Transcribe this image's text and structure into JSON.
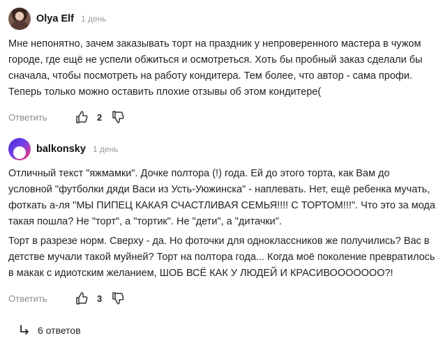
{
  "comments": [
    {
      "author": "Olya Elf",
      "time": "1 день",
      "paragraphs": [
        "Мне непонятно, зачем заказывать торт на праздник у непроверенного мастера в чужом городе, где ещё не успели обжиться и осмотреться. Хоть бы пробный заказ сделали бы сначала, чтобы посмотреть на работу кондитера. Тем более, что автор - сама профи. Теперь только можно оставить плохие отзывы об этом кондитере("
      ],
      "reply_label": "Ответить",
      "likes": "2"
    },
    {
      "author": "balkonsky",
      "time": "1 день",
      "paragraphs": [
        "Отличный текст \"яжмамки\". Дочке полтора (!) года. Ей до этого торта, как Вам до условной \"футболки дяди Васи из Усть-Уюжинска\" - наплевать. Нет, ещё ребенка мучать, фоткать а-ля \"МЫ ПИПЕЦ КАКАЯ СЧАСТЛИВАЯ СЕМЬЯ!!!! С ТОРТОМ!!!\". Что это за мода такая пошла? Не \"торт\", а \"тортик\". Не \"дети\", а \"дитачки\".",
        "Торт в разрезе норм. Сверху - да. Но фоточки для одноклассников же получились? Вас в детстве мучали такой муйней? Торт на полтора года... Когда моё поколение превратилось в макак с идиотским желанием, ШОБ ВСЁ КАК У ЛЮДЕЙ И КРАСИВООООООО?!"
      ],
      "reply_label": "Ответить",
      "likes": "3",
      "replies_label": "6 ответов"
    }
  ],
  "icons": {
    "like": "thumbs-up-icon",
    "dislike": "thumbs-down-icon",
    "replies": "reply-arrow-icon"
  },
  "colors": {
    "text": "#222222",
    "muted": "#8c8c8c",
    "time": "#9a9a9a"
  }
}
